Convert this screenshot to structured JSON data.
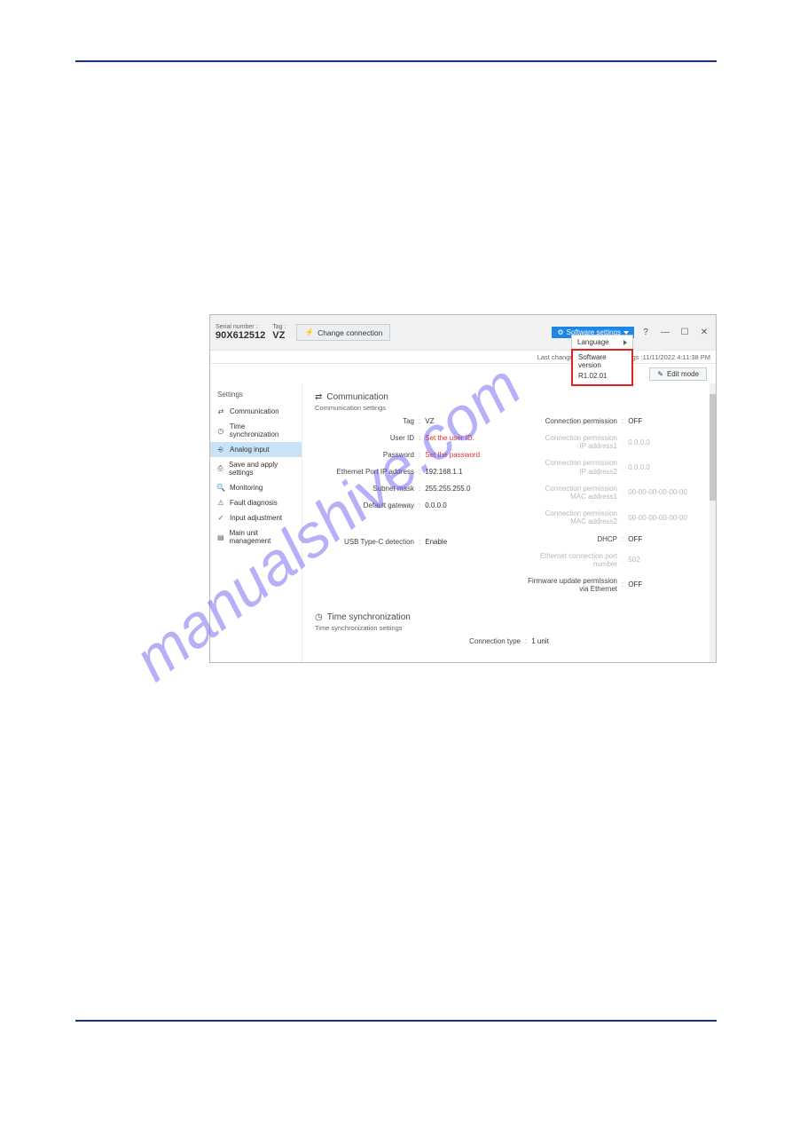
{
  "titlebar": {
    "serial_label": "Serial number :",
    "serial_value": "90X612512",
    "tag_label": "Tag :",
    "tag_value": "VZ",
    "change_connection": "Change connection",
    "software_settings": "Software settings",
    "help_glyph": "?",
    "minimize_glyph": "—",
    "maximize_glyph": "☐",
    "close_glyph": "✕"
  },
  "dropdown": {
    "language_label": "Language",
    "software_version_label": "Software version",
    "software_version_value": "R1.02.01"
  },
  "metabar": {
    "last_changed_prefix": "Last changed d",
    "settings_suffix": "ettings :11/11/2022 4:11:38 PM"
  },
  "edit_button": "Edit mode",
  "sidebar": {
    "title": "Settings",
    "items": [
      {
        "label": "Communication",
        "icon": "link-icon"
      },
      {
        "label": "Time synchronization",
        "icon": "clock-icon"
      },
      {
        "label": "Analog input",
        "icon": "input-icon"
      },
      {
        "label": "Save and apply settings",
        "icon": "save-icon"
      },
      {
        "label": "Monitoring",
        "icon": "monitor-icon"
      },
      {
        "label": "Fault diagnosis",
        "icon": "diagnosis-icon"
      },
      {
        "label": "Input adjustment",
        "icon": "adjust-icon"
      },
      {
        "label": "Main unit management",
        "icon": "manage-icon"
      }
    ]
  },
  "sections": {
    "communication": {
      "title": "Communication",
      "subtitle": "Communication settings",
      "left": [
        {
          "label": "Tag",
          "value": "VZ"
        },
        {
          "label": "User ID",
          "value": "Set the user ID.",
          "red": true
        },
        {
          "label": "Password",
          "value": "Set the password",
          "red": true
        },
        {
          "label": "Ethernet Port IP address",
          "value": "192.168.1.1"
        },
        {
          "label": "Subnet mask",
          "value": "255.255.255.0"
        },
        {
          "label": "Default gateway",
          "value": "0.0.0.0"
        },
        {
          "label": "USB Type-C detection",
          "value": "Enable"
        }
      ],
      "right": [
        {
          "label": "Connection permission",
          "value": "OFF"
        },
        {
          "label": "Connection permission\nIP address1",
          "value": "0.0.0.0",
          "faded": true,
          "multiline": true
        },
        {
          "label": "Connection permission\nIP address2",
          "value": "0.0.0.0",
          "faded": true,
          "multiline": true
        },
        {
          "label": "Connection permission\nMAC address1",
          "value": "00-00-00-00-00-00",
          "faded": true,
          "multiline": true
        },
        {
          "label": "Connection permission\nMAC address2",
          "value": "00-00-00-00-00-00",
          "faded": true,
          "multiline": true
        },
        {
          "label": "DHCP",
          "value": "OFF"
        },
        {
          "label": "Ethernet connection port number",
          "value": "502",
          "faded": true
        },
        {
          "label": "Firmware update permission\nvia Ethernet",
          "value": "OFF",
          "multiline": true
        }
      ]
    },
    "time_sync": {
      "title": "Time synchronization",
      "subtitle": "Time synchronization settings",
      "rows": [
        {
          "label": "Connection type",
          "value": "1 unit"
        }
      ]
    }
  },
  "icons": {
    "gear": "⚙",
    "pencil": "✎",
    "link": "⇄",
    "clock": "◷",
    "input": "⎆",
    "save": "⎙",
    "monitor": "🔍",
    "diag": "⚠",
    "adjust": "✓",
    "manage": "▤",
    "plug": "⚡"
  },
  "watermark_text": "manualshive.com"
}
